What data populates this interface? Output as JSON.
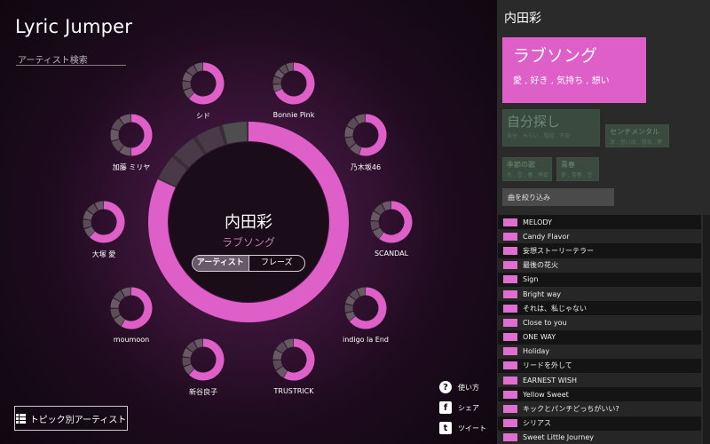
{
  "app": {
    "title": "Lyric Jumper"
  },
  "search": {
    "placeholder": "アーティスト検索"
  },
  "center": {
    "artist": "内田彩",
    "topic": "ラブソング",
    "modes": [
      {
        "label": "アーティスト",
        "active": true
      },
      {
        "label": "フレーズ",
        "active": false
      }
    ],
    "ring_share": 0.82
  },
  "artists": [
    {
      "name": "シド",
      "share": 0.62
    },
    {
      "name": "Bonnie Pink",
      "share": 0.68
    },
    {
      "name": "乃木坂46",
      "share": 0.55
    },
    {
      "name": "SCANDAL",
      "share": 0.6
    },
    {
      "name": "indigo la End",
      "share": 0.64
    },
    {
      "name": "TRUSTRICK",
      "share": 0.58
    },
    {
      "name": "新谷良子",
      "share": 0.62
    },
    {
      "name": "moumoon",
      "share": 0.58
    },
    {
      "name": "大塚 愛",
      "share": 0.62
    },
    {
      "name": "加藤 ミリヤ",
      "share": 0.5
    }
  ],
  "buttons": {
    "topic_artists": "トピック別アーティスト"
  },
  "utilities": [
    {
      "label": "使い方",
      "icon": "help-icon"
    },
    {
      "label": "シェア",
      "icon": "facebook-icon"
    },
    {
      "label": "ツイート",
      "icon": "twitter-icon"
    }
  ],
  "panel": {
    "artist": "内田彩",
    "topic_main": {
      "title": "ラブソング",
      "keywords": "愛 , 好き , 気持ち , 想い"
    },
    "topics": [
      {
        "title": "自分探し",
        "keywords": "自分 , みらい , 階段 , 不安"
      },
      {
        "title": "センチメンタル",
        "keywords": "涙 , 思い出 , 過去 , 夢"
      },
      {
        "title": "季節の歌",
        "keywords": "冬 , 雪 , 春 , 季節"
      },
      {
        "title": "青春",
        "keywords": "夢 , 青春 , 空"
      }
    ],
    "filter_placeholder": "曲を絞り込み",
    "songs": [
      "MELODY",
      "Candy Flavor",
      "妄想ストーリーテラー",
      "最後の花火",
      "Sign",
      "Bright way",
      "それは、私じゃない",
      "Close to you",
      "ONE WAY",
      "Holiday",
      "リードを外して",
      "EARNEST WISH",
      "Yellow Sweet",
      "キックとパンチどっちがいい?",
      "シリアス",
      "Sweet Little Journey"
    ]
  },
  "colors": {
    "accent": "#dd5fc7",
    "ring_gray": "#4a3e48"
  }
}
